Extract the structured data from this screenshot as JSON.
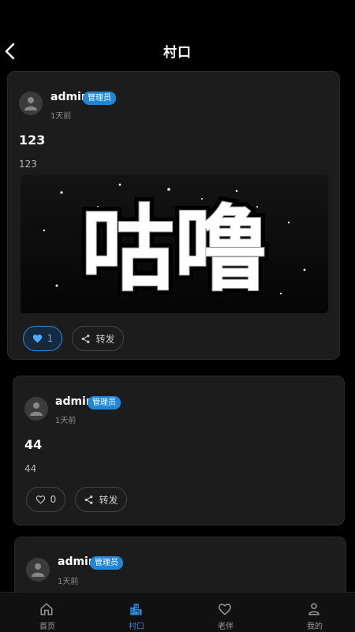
{
  "header": {
    "title": "村口"
  },
  "posts": [
    {
      "username": "admin",
      "badge": "管理员",
      "time": "1天前",
      "title": "123",
      "body": "123",
      "image_text": "咕噜",
      "like_count": "1",
      "liked": true,
      "share_label": "转发"
    },
    {
      "username": "admin",
      "badge": "管理员",
      "time": "1天前",
      "title": "44",
      "body": "44",
      "like_count": "0",
      "liked": false,
      "share_label": "转发"
    },
    {
      "username": "admin",
      "badge": "管理员",
      "time": "1天前"
    }
  ],
  "tabbar": {
    "items": [
      {
        "label": "首页",
        "icon": "home-icon",
        "active": false
      },
      {
        "label": "村口",
        "icon": "building-icon",
        "active": true
      },
      {
        "label": "老伴",
        "icon": "heart-icon",
        "active": false
      },
      {
        "label": "我的",
        "icon": "user-icon",
        "active": false
      }
    ]
  },
  "colors": {
    "accent": "#2a8ae0",
    "badge": "#1f86d8",
    "card": "#1c1c1c",
    "background": "#000000"
  }
}
